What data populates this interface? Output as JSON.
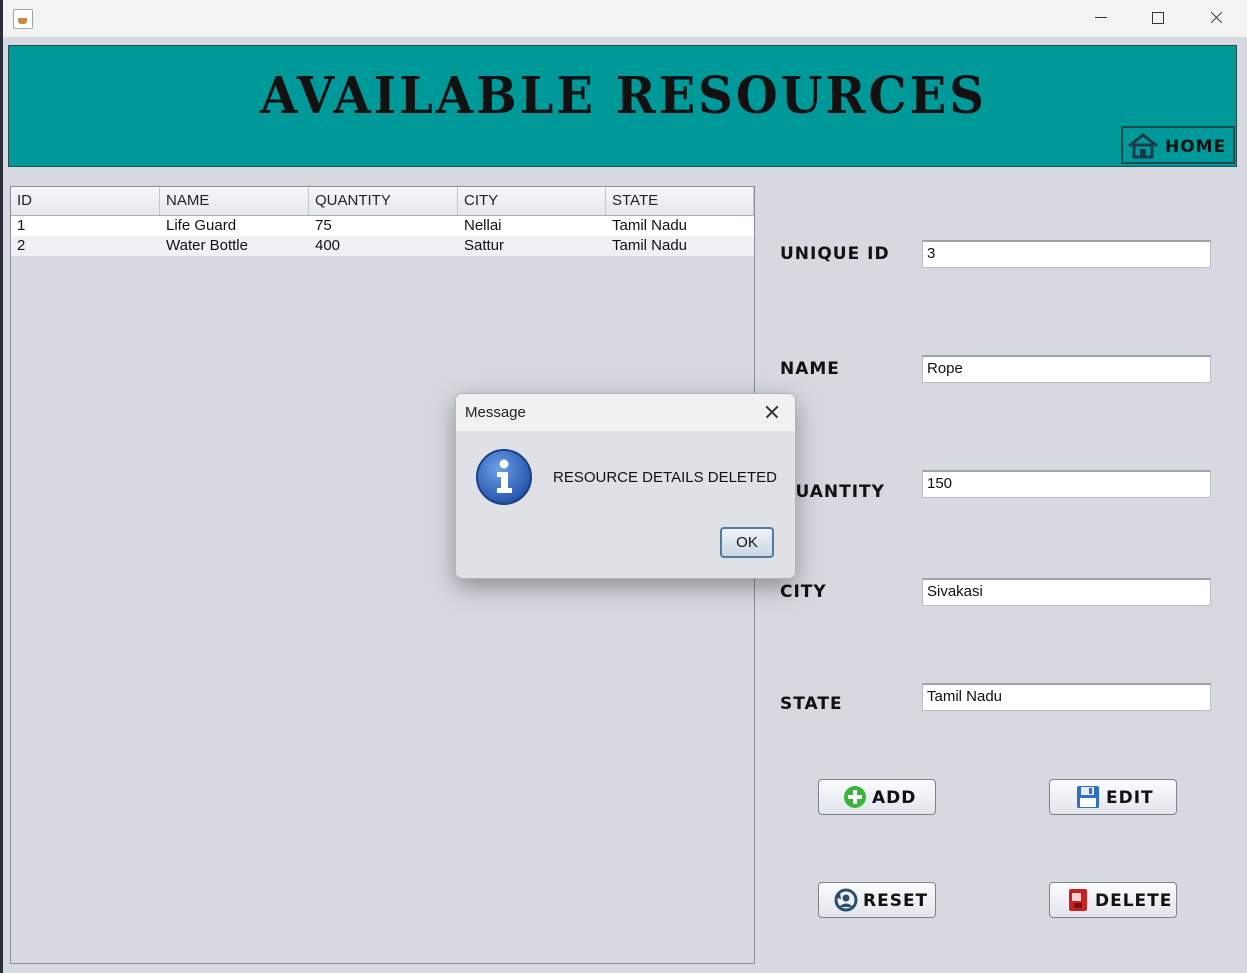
{
  "header": {
    "title": "AVAILABLE RESOURCES",
    "home_label": "HOME"
  },
  "table": {
    "columns": [
      "ID",
      "NAME",
      "QUANTITY",
      "CITY",
      "STATE"
    ],
    "rows": [
      [
        "1",
        "Life Guard",
        "75",
        "Nellai",
        "Tamil Nadu"
      ],
      [
        "2",
        "Water Bottle",
        "400",
        "Sattur",
        "Tamil Nadu"
      ]
    ]
  },
  "form": {
    "id_label": "UNIQUE ID",
    "id_value": "3",
    "name_label": "NAME",
    "name_value": "Rope",
    "quantity_label": "QUANTITY",
    "quantity_value": "150",
    "city_label": "CITY",
    "city_value": "Sivakasi",
    "state_label": "STATE",
    "state_value": "Tamil Nadu"
  },
  "buttons": {
    "add": "ADD",
    "edit": "EDIT",
    "reset": "RESET",
    "delete": "DELETE"
  },
  "dialog": {
    "title": "Message",
    "message": "RESOURCE DETAILS DELETED",
    "ok": "OK"
  },
  "colors": {
    "header_bg": "#009999",
    "window_bg": "#d6d9e0"
  }
}
